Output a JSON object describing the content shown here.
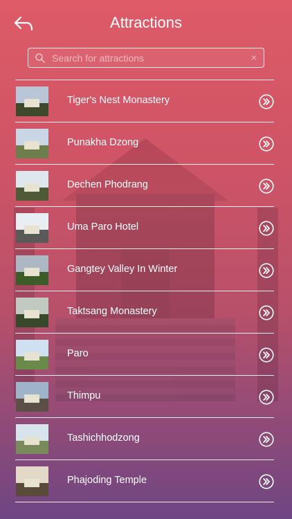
{
  "header": {
    "title": "Attractions",
    "back_icon": "back-arrow-icon"
  },
  "search": {
    "placeholder": "Search for attractions",
    "value": "",
    "search_icon": "search-icon",
    "clear_icon": "clear-icon",
    "clear_glyph": "×"
  },
  "colors": {
    "gradient_top": "#de5b67",
    "gradient_bottom": "#6e4683",
    "text": "#ffffff"
  },
  "items": [
    {
      "label": "Tiger's Nest Monastery"
    },
    {
      "label": "Punakha Dzong"
    },
    {
      "label": "Dechen Phodrang"
    },
    {
      "label": "Uma Paro Hotel"
    },
    {
      "label": "Gangtey Valley In Winter"
    },
    {
      "label": "Taktsang Monastery"
    },
    {
      "label": "Paro"
    },
    {
      "label": "Thimpu"
    },
    {
      "label": "Tashichhodzong"
    },
    {
      "label": "Phajoding Temple"
    }
  ]
}
